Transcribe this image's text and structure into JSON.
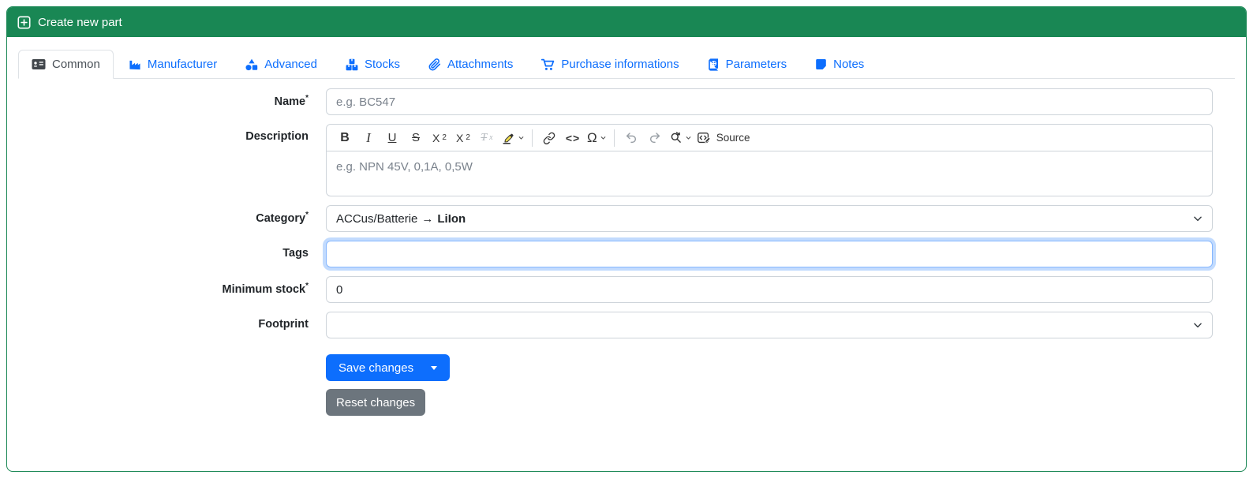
{
  "header": {
    "title": "Create new part"
  },
  "tabs": [
    {
      "label": "Common",
      "active": true
    },
    {
      "label": "Manufacturer",
      "active": false
    },
    {
      "label": "Advanced",
      "active": false
    },
    {
      "label": "Stocks",
      "active": false
    },
    {
      "label": "Attachments",
      "active": false
    },
    {
      "label": "Purchase informations",
      "active": false
    },
    {
      "label": "Parameters",
      "active": false
    },
    {
      "label": "Notes",
      "active": false
    }
  ],
  "form": {
    "name": {
      "label": "Name",
      "required_mark": "*",
      "placeholder": "e.g. BC547",
      "value": ""
    },
    "description": {
      "label": "Description",
      "placeholder": "e.g. NPN 45V, 0,1A, 0,5W",
      "value": ""
    },
    "category": {
      "label": "Category",
      "required_mark": "*",
      "selected_path": "ACCus/Batterie",
      "arrow": "→",
      "selected_name": "LiIon"
    },
    "tags": {
      "label": "Tags",
      "value": "",
      "focused": true
    },
    "minimum_stock": {
      "label": "Minimum stock",
      "required_mark": "*",
      "value": "0"
    },
    "footprint": {
      "label": "Footprint",
      "value": ""
    }
  },
  "editor_toolbar": {
    "bold": "B",
    "italic": "I",
    "underline": "U",
    "strikethrough": "S",
    "subscript_base": "X",
    "subscript_mark": "2",
    "superscript_base": "X",
    "superscript_mark": "2",
    "remove_format_base": "T",
    "remove_format_mark": "x",
    "code": "<>",
    "special_char": "Ω",
    "source_label": "Source"
  },
  "buttons": {
    "save": "Save changes",
    "reset": "Reset changes"
  },
  "colors": {
    "header_green": "#198754",
    "accent_blue": "#0d6efd",
    "reset_gray": "#6c757d",
    "focus_ring": "#86b7fe"
  }
}
